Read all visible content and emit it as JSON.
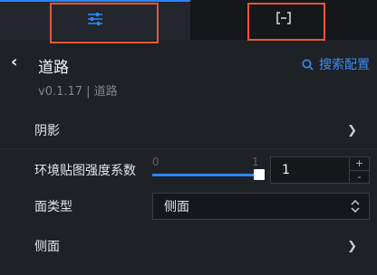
{
  "tabs": [
    {
      "name": "settings",
      "icon": "sliders-icon",
      "active": true
    },
    {
      "name": "expand",
      "icon": "bracket-expand-icon",
      "active": false
    }
  ],
  "header": {
    "title": "道路",
    "version": "v0.1.17 | 道路",
    "search_label": "搜索配置"
  },
  "sections": {
    "shadow_label": "阴影",
    "env_label": "环境贴图强度系数",
    "face_type_label": "面类型",
    "side_label": "侧面"
  },
  "env_slider": {
    "min_label": "0",
    "max_label": "1",
    "value": 1,
    "input_value": "1",
    "plus": "+",
    "minus": "-"
  },
  "face_type_select": {
    "value": "侧面"
  },
  "colors": {
    "accent": "#2b86f6",
    "highlight_box": "#e8553d",
    "background": "#1e2126"
  }
}
